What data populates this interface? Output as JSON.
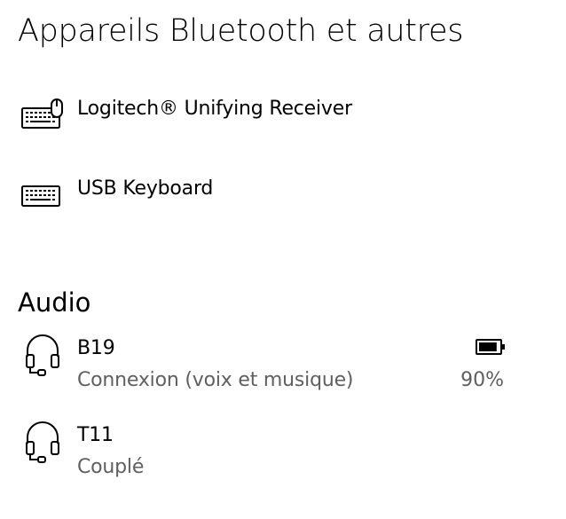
{
  "page": {
    "title": "Appareils Bluetooth et autres"
  },
  "other_devices": [
    {
      "name": "Logitech® Unifying Receiver",
      "icon": "keyboard-mouse-icon"
    },
    {
      "name": "USB Keyboard",
      "icon": "keyboard-icon"
    }
  ],
  "audio": {
    "section_title": "Audio",
    "devices": [
      {
        "name": "B19",
        "status": "Connexion (voix et musique)",
        "icon": "headset-icon",
        "battery_percent": 90,
        "battery_label": "90%"
      },
      {
        "name": "T11",
        "status": "Couplé",
        "icon": "headset-icon"
      }
    ]
  }
}
